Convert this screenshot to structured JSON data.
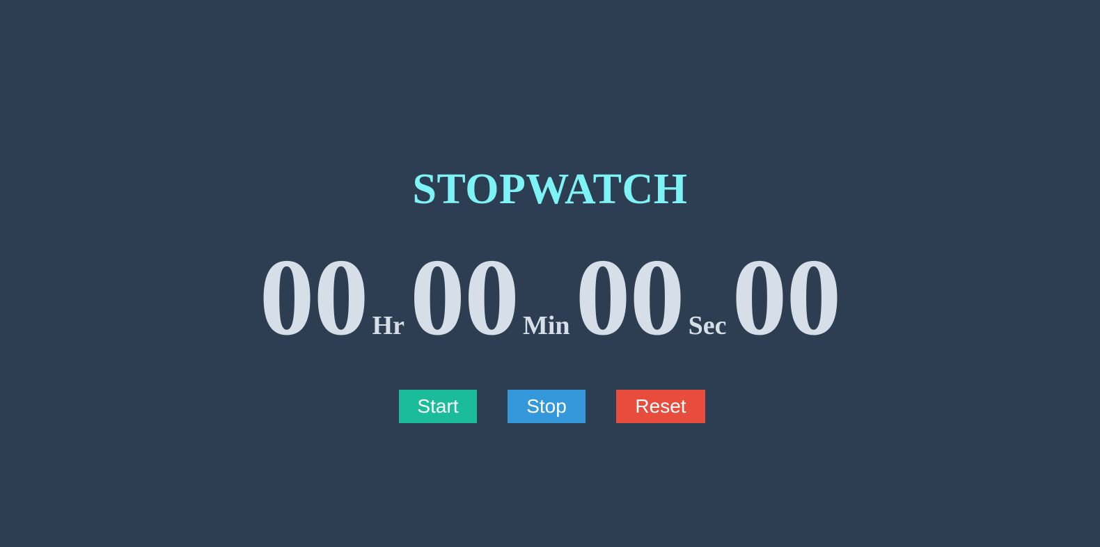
{
  "title": "STOPWATCH",
  "timer": {
    "hours": "00",
    "hours_unit": "Hr",
    "minutes": "00",
    "minutes_unit": "Min",
    "seconds": "00",
    "seconds_unit": "Sec",
    "centiseconds": "00"
  },
  "controls": {
    "start_label": "Start",
    "stop_label": "Stop",
    "reset_label": "Reset"
  },
  "colors": {
    "background": "#2e3e52",
    "title": "#7df3f5",
    "digits": "#d6dfe7",
    "start": "#1abc9c",
    "stop": "#3498db",
    "reset": "#e74c3c"
  }
}
